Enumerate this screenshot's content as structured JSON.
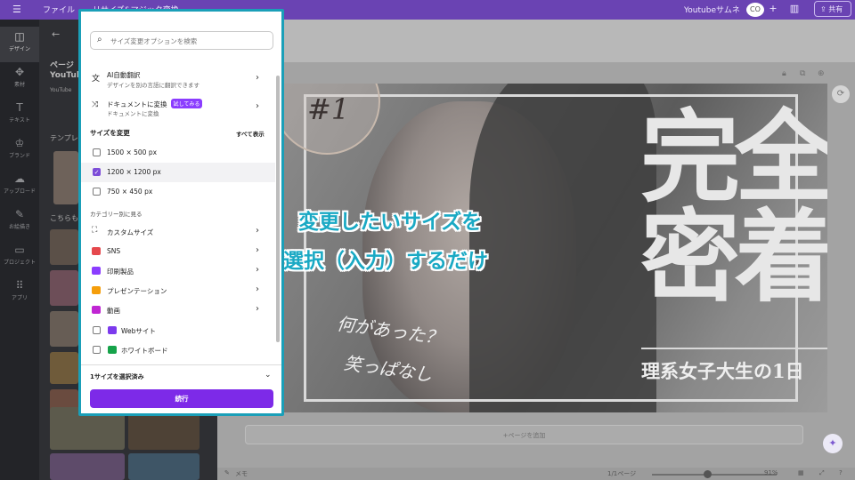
{
  "topbar": {
    "file_label": "ファイル",
    "resize_label": "リサイズ&マジック変換",
    "doc_title": "Youtubeサムネ",
    "plus_label": "+",
    "share_label": "共有"
  },
  "rail": {
    "items": [
      {
        "label": "デザイン",
        "icon": "design-icon"
      },
      {
        "label": "素材",
        "icon": "elements-icon"
      },
      {
        "label": "テキスト",
        "icon": "text-icon"
      },
      {
        "label": "ブランド",
        "icon": "brand-icon"
      },
      {
        "label": "アップロード",
        "icon": "upload-icon"
      },
      {
        "label": "お絵描き",
        "icon": "draw-icon"
      },
      {
        "label": "プロジェクト",
        "icon": "projects-icon"
      },
      {
        "label": "アプリ",
        "icon": "apps-icon"
      }
    ]
  },
  "sidepanel": {
    "heading1": "ページ",
    "heading2": "YouTube",
    "sub": "YouTube",
    "templates_label": "テンプレ",
    "more_label": "こちらも"
  },
  "popup": {
    "search_placeholder": "サイズ変更オプションを検索",
    "ai_translate_title": "AI自動翻訳",
    "ai_translate_desc": "デザインを別の言語に翻訳できます",
    "doc_convert_title": "ドキュメントに変換",
    "doc_convert_badge": "試してみる",
    "doc_convert_desc": "ドキュメントに変換",
    "resize_section": "サイズを変更",
    "show_all": "すべて表示",
    "sizes": [
      {
        "label": "1500 × 500 px",
        "checked": false
      },
      {
        "label": "1200 × 1200 px",
        "checked": true
      },
      {
        "label": "750 × 450 px",
        "checked": false
      }
    ],
    "category_section": "カテゴリー別に見る",
    "categories": [
      {
        "label": "カスタムサイズ",
        "icon": "custom-size-icon"
      },
      {
        "label": "SNS",
        "icon": "sns-icon"
      },
      {
        "label": "印刷製品",
        "icon": "print-icon"
      },
      {
        "label": "プレゼンテーション",
        "icon": "presentation-icon"
      },
      {
        "label": "動画",
        "icon": "video-icon"
      }
    ],
    "web_label": "Webサイト",
    "whiteboard_label": "ホワイトボード",
    "footer_label": "1サイズを選択済み",
    "continue_label": "続行"
  },
  "canvas": {
    "number": "#1",
    "title_line1": "完全",
    "title_line2": "密着",
    "subtitle": "理系女子大生の1日",
    "hand1": "何があった？",
    "hand2": "笑っぱなし",
    "add_page": "+ページを追加"
  },
  "caption": {
    "line1": "変更したいサイズを",
    "line2": "選択（入力）するだけ"
  },
  "bottombar": {
    "notes": "メモ",
    "page_count": "1/1ページ",
    "zoom": "91%"
  },
  "colors": {
    "accent": "#7d2ae8",
    "caption": "#1aa9c4",
    "frame": "#1a9fb8"
  }
}
